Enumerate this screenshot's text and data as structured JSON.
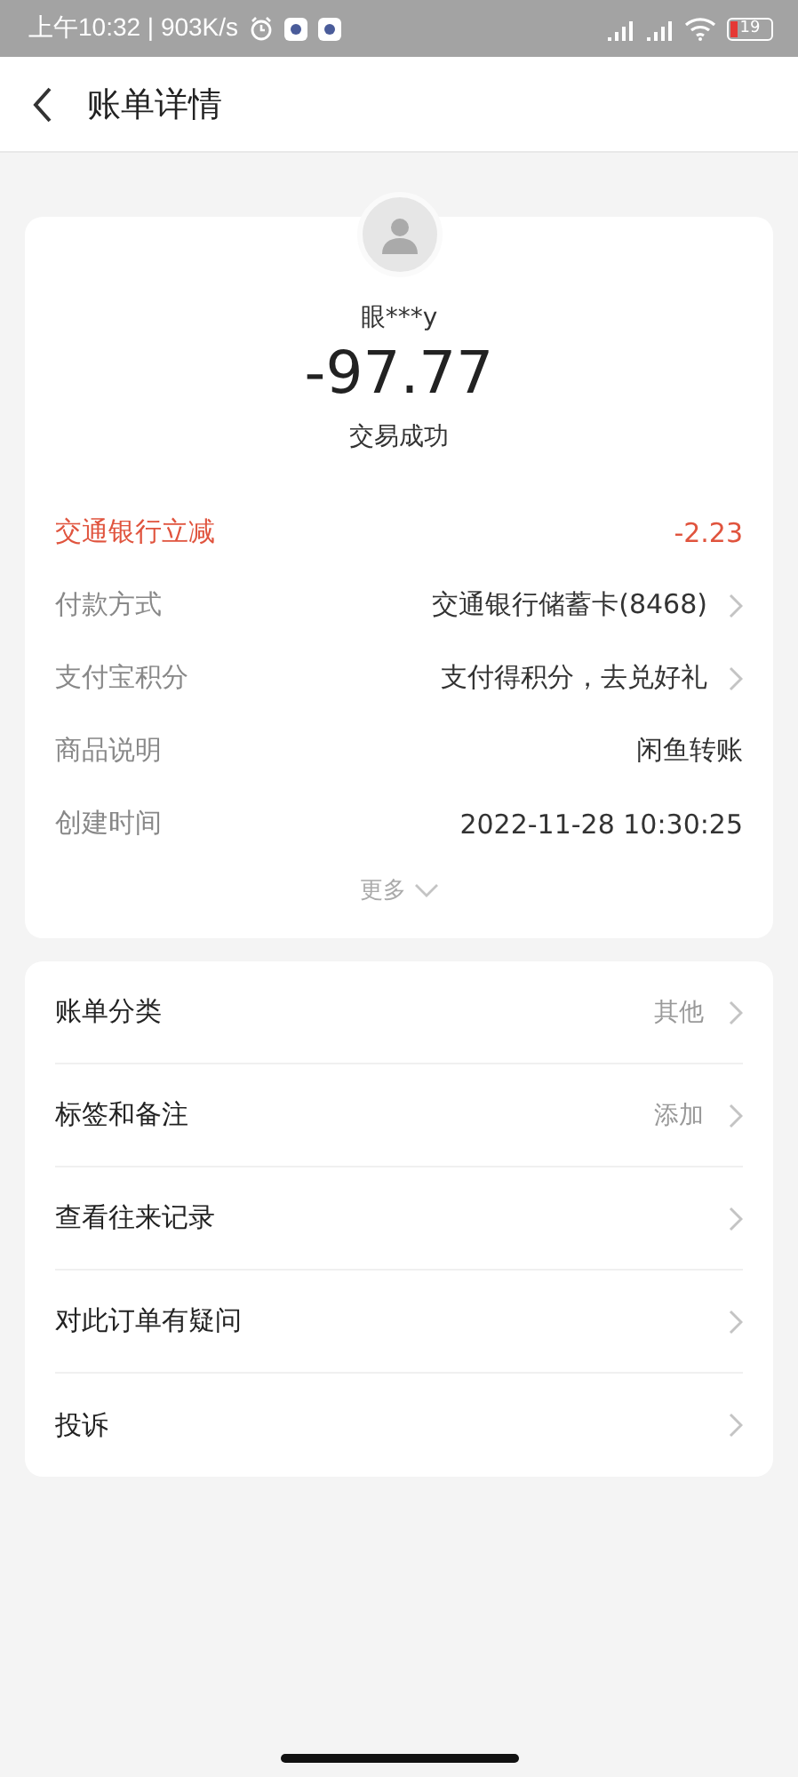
{
  "status_bar": {
    "time_speed": "上午10:32 | 903K/s",
    "battery": "19"
  },
  "header": {
    "title": "账单详情"
  },
  "summary": {
    "name": "眼***y",
    "amount": "-97.77",
    "status": "交易成功"
  },
  "details": [
    {
      "kind": "highlight",
      "label": "交通银行立减",
      "value": "-2.23",
      "arrow": false
    },
    {
      "kind": "normal",
      "label": "付款方式",
      "value": "交通银行储蓄卡(8468)",
      "arrow": true
    },
    {
      "kind": "normal",
      "label": "支付宝积分",
      "value": "支付得积分，去兑好礼",
      "arrow": true
    },
    {
      "kind": "normal",
      "label": "商品说明",
      "value": "闲鱼转账",
      "arrow": false
    },
    {
      "kind": "normal",
      "label": "创建时间",
      "value": "2022-11-28 10:30:25",
      "arrow": false
    }
  ],
  "more": "更多",
  "menu": [
    {
      "label": "账单分类",
      "value": "其他"
    },
    {
      "label": "标签和备注",
      "value": "添加"
    },
    {
      "label": "查看往来记录"
    },
    {
      "label": "对此订单有疑问"
    },
    {
      "label": "投诉"
    }
  ]
}
